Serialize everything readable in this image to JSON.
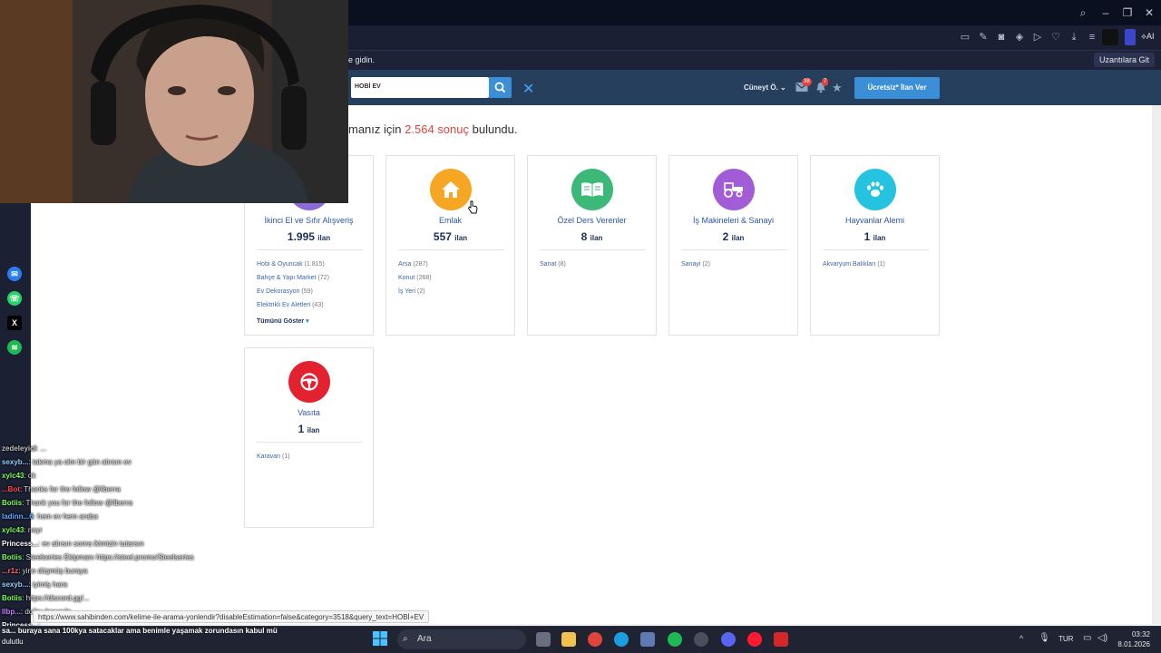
{
  "browser": {
    "bookmark_hint": "e gidin.",
    "extensions_button": "Uzantılara Git",
    "ai_label": "AI"
  },
  "site": {
    "search_value": "HOBİ EV",
    "user_name": "Cüneyt Ö.",
    "messages_badge": "38",
    "notifications_badge": "7",
    "post_button": "Ücretsiz* İlan Ver",
    "result_prefix": "manız için",
    "result_count": "2.564 sonuç",
    "result_suffix": "bulundu.",
    "unit": "ilan",
    "categories": [
      {
        "name": "İkinci El ve Sıfır Alışveriş",
        "count": "1.995",
        "icon": "shopping-icon",
        "color": "#8e6ad6",
        "subs": [
          {
            "label": "Hobi & Oyuncak",
            "count": "(1.815)"
          },
          {
            "label": "Bahçe & Yapı Market",
            "count": "(72)"
          },
          {
            "label": "Ev Dekorasyon",
            "count": "(59)"
          },
          {
            "label": "Elektrikli Ev Aletleri",
            "count": "(43)"
          }
        ],
        "more": "Tümünü Göster"
      },
      {
        "name": "Emlak",
        "count": "557",
        "icon": "house-icon",
        "color": "#f5a623",
        "subs": [
          {
            "label": "Arsa",
            "count": "(287)"
          },
          {
            "label": "Konut",
            "count": "(268)"
          },
          {
            "label": "İş Yeri",
            "count": "(2)"
          }
        ]
      },
      {
        "name": "Özel Ders Verenler",
        "count": "8",
        "icon": "book-icon",
        "color": "#3cb878",
        "subs": [
          {
            "label": "Sanat",
            "count": "(8)"
          }
        ]
      },
      {
        "name": "İş Makineleri & Sanayi",
        "count": "2",
        "icon": "tractor-icon",
        "color": "#a25cd6",
        "subs": [
          {
            "label": "Sanayi",
            "count": "(2)"
          }
        ]
      },
      {
        "name": "Hayvanlar Alemi",
        "count": "1",
        "icon": "paw-icon",
        "color": "#25c3e0",
        "subs": [
          {
            "label": "Akvaryum Balıkları",
            "count": "(1)"
          }
        ]
      },
      {
        "name": "Vasıta",
        "count": "1",
        "icon": "steering-wheel-icon",
        "color": "#e3222f",
        "subs": [
          {
            "label": "Karavan",
            "count": "(1)"
          }
        ]
      }
    ]
  },
  "status_url": "https://www.sahibinden.com/kelime-ile-arama-yonlendir?disableEstimation=false&category=3518&query_text=HOBİ+EV",
  "chat": [
    {
      "user": "zedeleyici",
      "color": "#c0c0c0",
      "text": ": ..."
    },
    {
      "user": "sexyb...",
      "color": "#9ad0ff",
      "text": ": takma ya olm bir gün alırsın ev"
    },
    {
      "user": "xylc43",
      "color": "#7cff5a",
      "text": ": ok"
    },
    {
      "user": "...Bot",
      "color": "#ff4d4d",
      "text": ": Thanks for the follow @llberra"
    },
    {
      "user": "Botiis",
      "color": "#7cff5a",
      "text": ": Thank you for the follow @llberra"
    },
    {
      "user": "ladinn...6",
      "color": "#6aa8ff",
      "text": ": hem ev hem araba"
    },
    {
      "user": "xylc43",
      "color": "#7cff5a",
      "text": ": neyr"
    },
    {
      "user": "Princess...",
      "color": "#ffffff",
      "text": ": ev alırsın sonra ikimizin tutarsın"
    },
    {
      "user": "Botiis",
      "color": "#7cff5a",
      "text": ": Steelseries Ekipmanı https://steel.promo/Steelseries"
    },
    {
      "user": "...r1z",
      "color": "#ff6b6b",
      "text": ": yine düşmüş buraya"
    },
    {
      "user": "sexyb...",
      "color": "#9ad0ff",
      "text": ": iyimiş hara"
    },
    {
      "user": "Botiis",
      "color": "#7cff5a",
      "text": ": https://discord.gg/..."
    },
    {
      "user": "llbp...",
      "color": "#c580ff",
      "text": ": doğru başında"
    },
    {
      "user": "Princess...",
      "color": "#ffffff",
      "text": ": ..."
    }
  ],
  "overlay_text": "sa... buraya sana 100kya satacaklar ama benimle yaşamak zorundasın kabul mü",
  "overlay_text2": "dulutlu",
  "taskbar": {
    "search_placeholder": "Ara",
    "lang": "TUR",
    "time": "03:32",
    "date": "8.01.2026"
  }
}
